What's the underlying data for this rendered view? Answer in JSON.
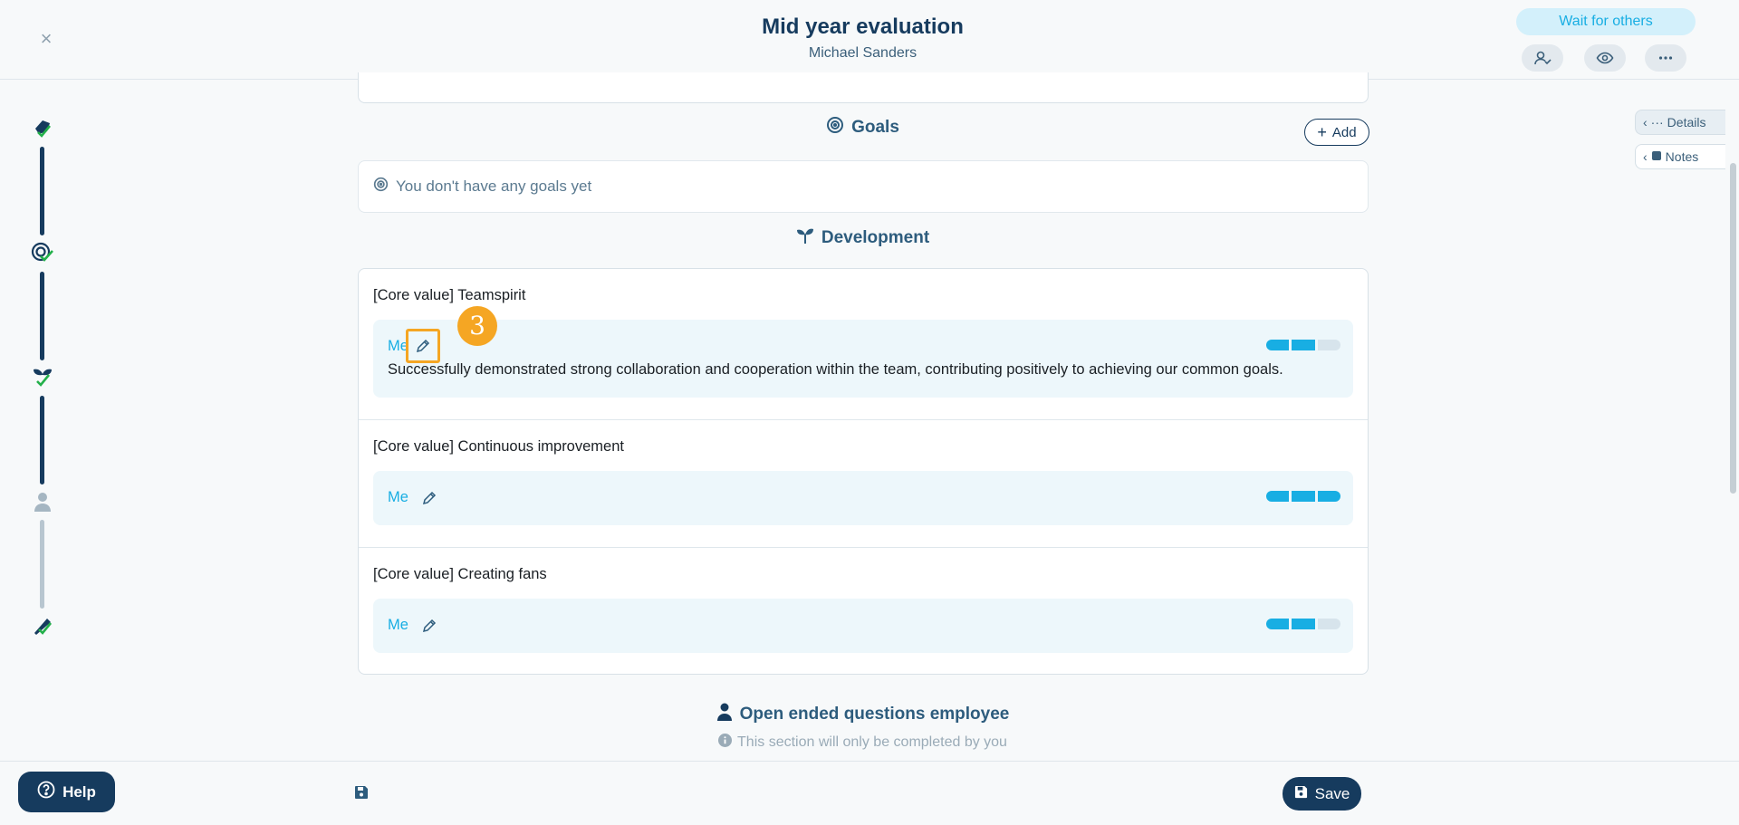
{
  "header": {
    "close_symbol": "×",
    "title": "Mid year evaluation",
    "subtitle": "Michael Sanders",
    "wait_label": "Wait for others",
    "icons": [
      "user-check-icon",
      "eye-icon",
      "more-icon"
    ]
  },
  "side_tabs": {
    "details_label": "Details",
    "notes_label": "Notes"
  },
  "goals": {
    "title": "Goals",
    "add_label": "Add",
    "empty_text": "You don't have any goals yet"
  },
  "development": {
    "title": "Development",
    "items": [
      {
        "title": "[Core value] Teamspirit",
        "who": "Me",
        "rating": 2,
        "rating_max": 3,
        "comment": "Successfully demonstrated strong collaboration and cooperation within the team, contributing positively to achieving our common goals."
      },
      {
        "title": "[Core value] Continuous improvement",
        "who": "Me",
        "rating": 3,
        "rating_max": 3,
        "comment": ""
      },
      {
        "title": "[Core value] Creating fans",
        "who": "Me",
        "rating": 2,
        "rating_max": 3,
        "comment": ""
      }
    ]
  },
  "step_badge": "3",
  "open_questions": {
    "title": "Open ended questions employee",
    "note": "This section will only be completed by you"
  },
  "footer": {
    "help_label": "Help",
    "save_label": "Save"
  },
  "colors": {
    "navy": "#163b5e",
    "accent": "#18aee3",
    "badge": "#f5a623"
  }
}
